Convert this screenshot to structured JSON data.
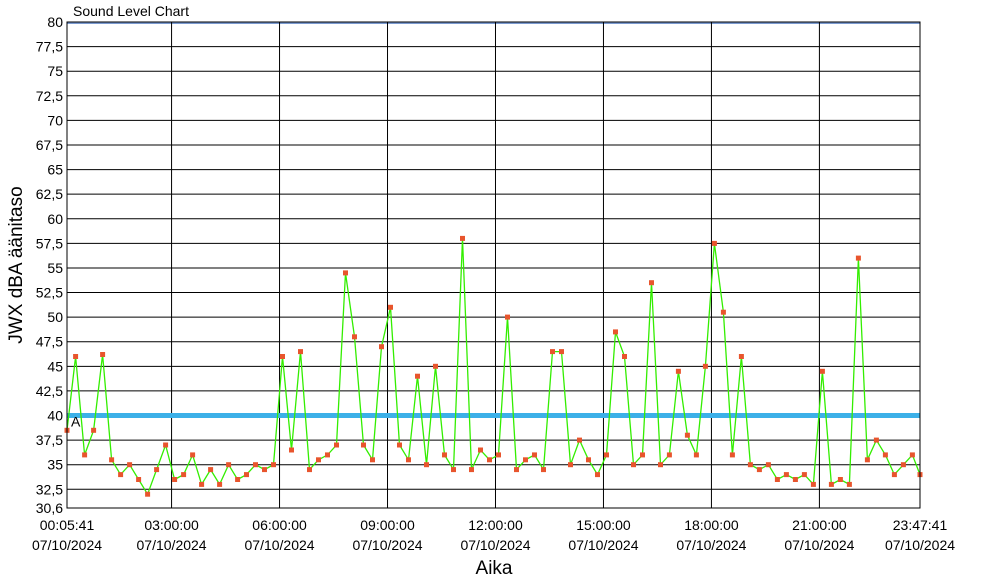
{
  "chart_data": {
    "type": "line",
    "title": "Sound Level Chart",
    "xlabel": "Aika",
    "ylabel": "JWX dBA äänitaso",
    "ylim": [
      30.6,
      80
    ],
    "y_ticks": [
      "80",
      "77,5",
      "75",
      "72,5",
      "70",
      "67,5",
      "65",
      "62,5",
      "60",
      "57,5",
      "55",
      "52,5",
      "50",
      "47,5",
      "45",
      "42,5",
      "40",
      "37,5",
      "35",
      "32,5",
      "30,6"
    ],
    "x_ticks": [
      {
        "time": "00:05:41",
        "date": "07/10/2024"
      },
      {
        "time": "03:00:00",
        "date": "07/10/2024"
      },
      {
        "time": "06:00:00",
        "date": "07/10/2024"
      },
      {
        "time": "09:00:00",
        "date": "07/10/2024"
      },
      {
        "time": "12:00:00",
        "date": "07/10/2024"
      },
      {
        "time": "15:00:00",
        "date": "07/10/2024"
      },
      {
        "time": "18:00:00",
        "date": "07/10/2024"
      },
      {
        "time": "21:00:00",
        "date": "07/10/2024"
      },
      {
        "time": "23:47:41",
        "date": "07/10/2024"
      }
    ],
    "reference_line": {
      "value": 40,
      "label": "A",
      "color": "#3cb0e8"
    },
    "grid": true,
    "series": [
      {
        "color": "#33ee00",
        "marker_color": "#e8552d",
        "x": [
          "00:05:41",
          "00:20",
          "00:35",
          "00:50",
          "01:05",
          "01:20",
          "01:35",
          "01:50",
          "02:05",
          "02:20",
          "02:35",
          "02:50",
          "03:05",
          "03:20",
          "03:35",
          "03:50",
          "04:05",
          "04:20",
          "04:35",
          "04:50",
          "05:05",
          "05:20",
          "05:35",
          "05:50",
          "06:05",
          "06:20",
          "06:35",
          "06:50",
          "07:05",
          "07:20",
          "07:35",
          "07:50",
          "08:05",
          "08:20",
          "08:35",
          "08:50",
          "09:05",
          "09:20",
          "09:35",
          "09:50",
          "10:05",
          "10:20",
          "10:35",
          "10:50",
          "11:05",
          "11:20",
          "11:35",
          "11:50",
          "12:05",
          "12:20",
          "12:35",
          "12:50",
          "13:05",
          "13:20",
          "13:35",
          "13:50",
          "14:05",
          "14:20",
          "14:35",
          "14:50",
          "15:05",
          "15:20",
          "15:35",
          "15:50",
          "16:05",
          "16:20",
          "16:35",
          "16:50",
          "17:05",
          "17:20",
          "17:35",
          "17:50",
          "18:05",
          "18:20",
          "18:35",
          "18:50",
          "19:05",
          "19:20",
          "19:35",
          "19:50",
          "20:05",
          "20:20",
          "20:35",
          "20:50",
          "21:05",
          "21:20",
          "21:35",
          "21:50",
          "22:05",
          "22:20",
          "22:35",
          "22:50",
          "23:05",
          "23:20",
          "23:35",
          "23:47:41"
        ],
        "values": [
          38.5,
          46.0,
          36.0,
          38.5,
          46.2,
          35.5,
          34.0,
          35.0,
          33.5,
          32.0,
          34.5,
          37.0,
          33.5,
          34.0,
          36.0,
          33.0,
          34.5,
          33.0,
          35.0,
          33.5,
          34.0,
          35.0,
          34.5,
          35.0,
          46.0,
          36.5,
          46.5,
          34.5,
          35.5,
          36.0,
          37.0,
          54.5,
          48.0,
          37.0,
          35.5,
          47.0,
          51.0,
          37.0,
          35.5,
          44.0,
          35.0,
          45.0,
          36.0,
          34.5,
          58.0,
          34.5,
          36.5,
          35.5,
          36.0,
          50.0,
          34.5,
          35.5,
          36.0,
          34.5,
          46.5,
          46.5,
          35.0,
          37.5,
          35.5,
          34.0,
          36.0,
          48.5,
          46.0,
          35.0,
          36.0,
          53.5,
          35.0,
          36.0,
          44.5,
          38.0,
          36.0,
          45.0,
          57.5,
          50.5,
          36.0,
          46.0,
          35.0,
          34.5,
          35.0,
          33.5,
          34.0,
          33.5,
          34.0,
          33.0,
          44.5,
          33.0,
          33.5,
          33.0,
          56.0,
          35.5,
          37.5,
          36.0,
          34.0,
          35.0,
          36.0,
          34.0
        ]
      }
    ]
  }
}
